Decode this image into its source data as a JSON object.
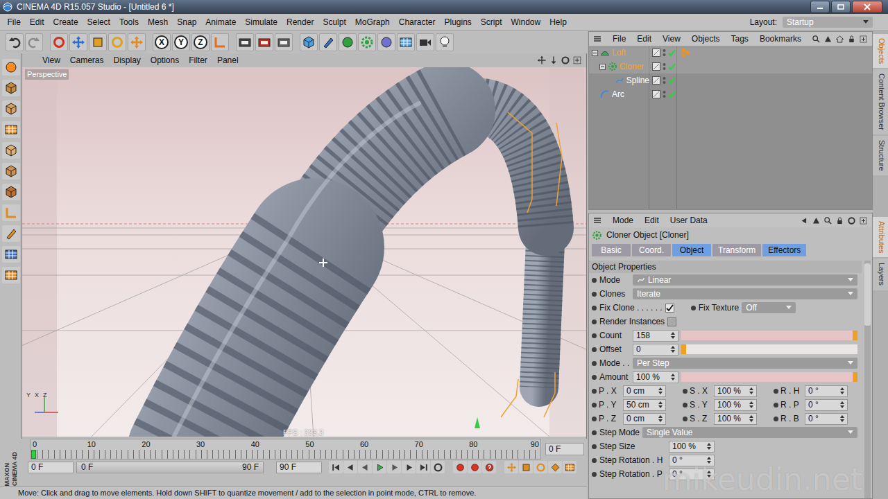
{
  "window": {
    "title": "CINEMA 4D R15.057 Studio - [Untitled 6 *]"
  },
  "menu": [
    "File",
    "Edit",
    "Create",
    "Select",
    "Tools",
    "Mesh",
    "Snap",
    "Animate",
    "Simulate",
    "Render",
    "Sculpt",
    "MoGraph",
    "Character",
    "Plugins",
    "Script",
    "Window",
    "Help"
  ],
  "layout": {
    "label": "Layout:",
    "value": "Startup"
  },
  "axis_lock": [
    "X",
    "Y",
    "Z"
  ],
  "viewport": {
    "menu": [
      "View",
      "Cameras",
      "Display",
      "Options",
      "Filter",
      "Panel"
    ],
    "camera": "Perspective",
    "fps": "FPS : 333.3",
    "gizmo": [
      "Y",
      "X",
      "Z"
    ]
  },
  "timeline": {
    "ticks": [
      "0",
      "10",
      "20",
      "30",
      "40",
      "50",
      "60",
      "70",
      "80",
      "90"
    ],
    "playhead": 0,
    "current_frame": "0 F",
    "start_field": "0 F",
    "range_start": "0 F",
    "range_end": "90 F",
    "end_field": "90 F"
  },
  "logo": [
    "MAXON",
    "CINEMA 4D"
  ],
  "status_bar": "Move: Click and drag to move elements. Hold down SHIFT to quantize movement / add to the selection in point mode, CTRL to remove.",
  "objects": {
    "menu": [
      "File",
      "Edit",
      "View",
      "Objects",
      "Tags",
      "Bookmarks"
    ],
    "items": [
      {
        "name": "Loft",
        "kind": "loft",
        "depth": 0,
        "expandable": true,
        "expanded": true,
        "selected": true,
        "enabled": true,
        "has_tag": true
      },
      {
        "name": "Cloner",
        "kind": "cloner",
        "depth": 1,
        "expandable": true,
        "expanded": true,
        "selected": true,
        "enabled": true,
        "has_tag": false
      },
      {
        "name": "Spline",
        "kind": "spline",
        "depth": 2,
        "expandable": false,
        "expanded": false,
        "selected": false,
        "enabled": true,
        "has_tag": false
      },
      {
        "name": "Arc",
        "kind": "arc",
        "depth": 0,
        "expandable": false,
        "expanded": false,
        "selected": false,
        "enabled": true,
        "has_tag": false
      }
    ]
  },
  "side_tabs": {
    "upper": [
      {
        "label": "Objects",
        "selected": true
      },
      {
        "label": "Content Browser",
        "selected": false
      },
      {
        "label": "Structure",
        "selected": false
      }
    ],
    "lower": [
      {
        "label": "Attributes",
        "selected": true
      },
      {
        "label": "Layers",
        "selected": false
      }
    ]
  },
  "attributes": {
    "menu": [
      "Mode",
      "Edit",
      "User Data"
    ],
    "title": "Cloner Object [Cloner]",
    "tabs": [
      {
        "label": "Basic",
        "selected": false
      },
      {
        "label": "Coord.",
        "selected": false
      },
      {
        "label": "Object",
        "selected": true
      },
      {
        "label": "Transform",
        "selected": false
      },
      {
        "label": "Effectors",
        "selected": true
      }
    ],
    "section": "Object Properties",
    "rows": [
      {
        "kind": "dropdown",
        "label": "Mode",
        "value": "Linear"
      },
      {
        "kind": "dropdown",
        "label": "Clones",
        "value": "Iterate"
      },
      {
        "kind": "check-pair",
        "label": "Fix Clone . . . . . .",
        "checked": true,
        "label2": "Fix Texture",
        "value": "Off"
      },
      {
        "kind": "checkbox",
        "label": "Render Instances",
        "checked": false
      },
      {
        "kind": "slider",
        "label": "Count",
        "value": "158",
        "level": 1
      },
      {
        "kind": "slider",
        "label": "Offset",
        "value": "0",
        "level": 0
      },
      {
        "kind": "dropdown",
        "label": "Mode . .",
        "value": "Per Step"
      },
      {
        "kind": "slider",
        "label": "Amount",
        "value": "100 %",
        "level": 1
      },
      {
        "kind": "triple",
        "cells": [
          {
            "label": "P . X",
            "value": "0 cm"
          },
          {
            "label": "S . X",
            "value": "100 %"
          },
          {
            "label": "R . H",
            "value": "0 °"
          }
        ]
      },
      {
        "kind": "triple",
        "cells": [
          {
            "label": "P . Y",
            "value": "50 cm"
          },
          {
            "label": "S . Y",
            "value": "100 %"
          },
          {
            "label": "R . P",
            "value": "0 °"
          }
        ]
      },
      {
        "kind": "triple",
        "cells": [
          {
            "label": "P . Z",
            "value": "0 cm"
          },
          {
            "label": "S . Z",
            "value": "100 %"
          },
          {
            "label": "R . B",
            "value": "0 °"
          }
        ]
      },
      {
        "kind": "dropdown",
        "label": "Step Mode",
        "value": "Single Value"
      },
      {
        "kind": "field",
        "label": "Step Size",
        "value": "100 %"
      },
      {
        "kind": "field",
        "label": "Step Rotation . H",
        "value": "0 °"
      },
      {
        "kind": "field",
        "label": "Step Rotation . P",
        "value": "0 °"
      }
    ]
  },
  "watermark": "mikeudin.net"
}
